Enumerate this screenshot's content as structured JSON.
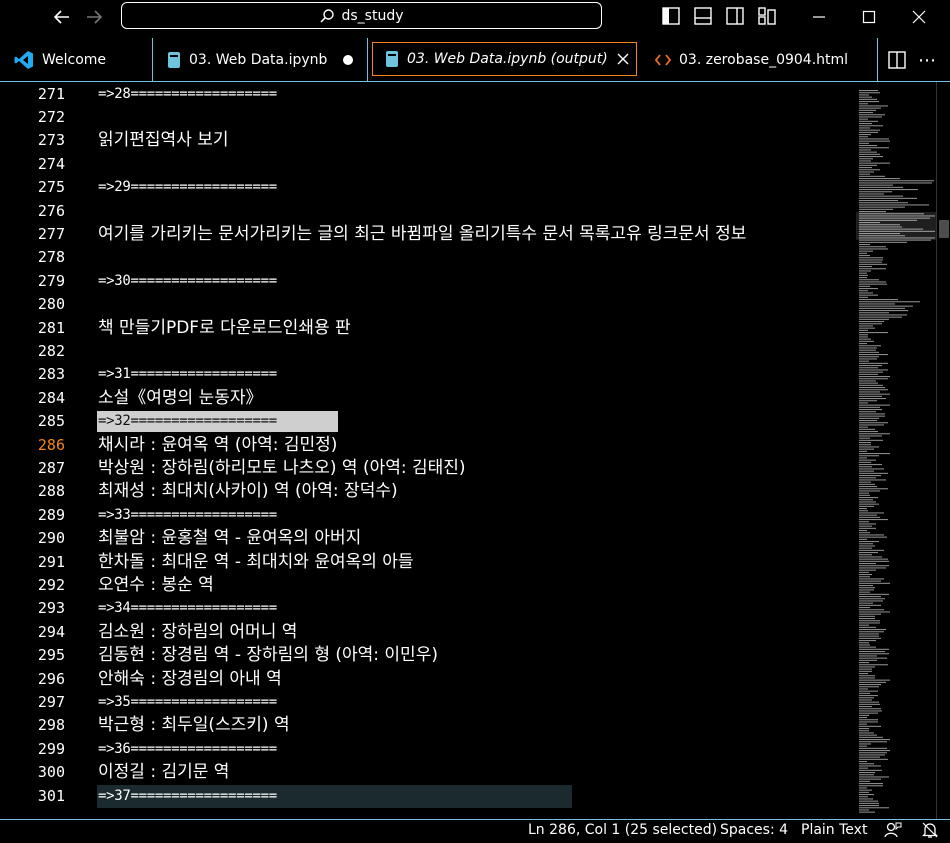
{
  "window": {
    "search_text": "ds_study"
  },
  "tabs": [
    {
      "label": "Welcome",
      "icon": "vscode-logo-icon"
    },
    {
      "label": "03. Web Data.ipynb",
      "icon": "notebook-icon",
      "modified": true
    },
    {
      "label": "03. Web Data.ipynb (output)",
      "icon": "notebook-icon",
      "active": true
    },
    {
      "label": "03. zerobase_0904.html",
      "icon": "html-code-icon"
    }
  ],
  "lines": [
    {
      "n": "271",
      "t": "=>28=================="
    },
    {
      "n": "272",
      "t": ""
    },
    {
      "n": "273",
      "t": "읽기편집역사 보기"
    },
    {
      "n": "274",
      "t": ""
    },
    {
      "n": "275",
      "t": "=>29=================="
    },
    {
      "n": "276",
      "t": ""
    },
    {
      "n": "277",
      "t": "여기를 가리키는 문서가리키는 글의 최근 바뀜파일 올리기특수 문서 목록고유 링크문서 정보"
    },
    {
      "n": "278",
      "t": ""
    },
    {
      "n": "279",
      "t": "=>30=================="
    },
    {
      "n": "280",
      "t": ""
    },
    {
      "n": "281",
      "t": "책 만들기PDF로 다운로드인쇄용 판"
    },
    {
      "n": "282",
      "t": ""
    },
    {
      "n": "283",
      "t": "=>31=================="
    },
    {
      "n": "284",
      "t": "소설《여명의 눈동자》"
    },
    {
      "n": "285",
      "t": "=>32=================="
    },
    {
      "n": "286",
      "t": "채시라 : 윤여옥 역 (아역: 김민정)"
    },
    {
      "n": "287",
      "t": "박상원 : 장하림(하리모토 나츠오) 역 (아역: 김태진)"
    },
    {
      "n": "288",
      "t": "최재성 : 최대치(사카이) 역 (아역: 장덕수)"
    },
    {
      "n": "289",
      "t": "=>33=================="
    },
    {
      "n": "290",
      "t": "최불암 : 윤홍철 역 - 윤여옥의 아버지"
    },
    {
      "n": "291",
      "t": "한차돌 : 최대운 역 - 최대치와 윤여옥의 아들"
    },
    {
      "n": "292",
      "t": "오연수 : 봉순 역"
    },
    {
      "n": "293",
      "t": "=>34=================="
    },
    {
      "n": "294",
      "t": "김소원 : 장하림의 어머니 역"
    },
    {
      "n": "295",
      "t": "김동현 : 장경림 역 - 장하림의 형 (아역: 이민우)"
    },
    {
      "n": "296",
      "t": "안해숙 : 장경림의 아내 역"
    },
    {
      "n": "297",
      "t": "=>35=================="
    },
    {
      "n": "298",
      "t": "박근형 : 최두일(스즈키) 역"
    },
    {
      "n": "299",
      "t": "=>36=================="
    },
    {
      "n": "300",
      "t": "이정길 : 김기문 역"
    },
    {
      "n": "301",
      "t": "=>37=================="
    }
  ],
  "editor": {
    "current_line": "286",
    "selected_line": "285",
    "highlighted_line": "301"
  },
  "status": {
    "cursor": "Ln 286, Col 1 (25 selected)",
    "spaces": "Spaces: 4",
    "language": "Plain Text"
  },
  "colors": {
    "accent_border": "#6fc3df",
    "active_tab_border": "#f38518",
    "current_line_number": "#f38518",
    "vscode_blue": "#23a9f2",
    "html_icon": "#f06a34"
  }
}
